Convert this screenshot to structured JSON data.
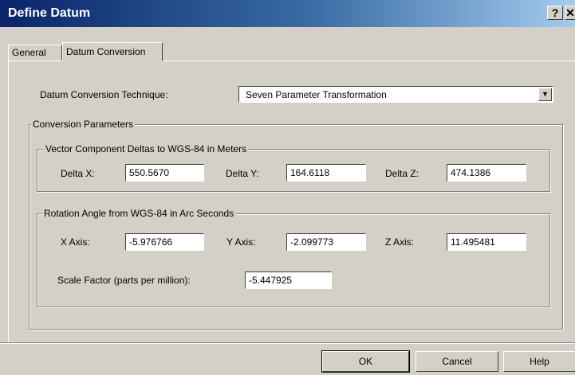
{
  "window": {
    "title": "Define Datum",
    "help_glyph": "?",
    "close_glyph": "✕"
  },
  "tabs": [
    {
      "label": "General",
      "active": false
    },
    {
      "label": "Datum Conversion",
      "active": true
    }
  ],
  "technique": {
    "label": "Datum Conversion Technique:",
    "value": "Seven Parameter Transformation"
  },
  "conversion_params": {
    "legend": "Conversion Parameters",
    "vector_group": {
      "legend": "Vector Component Deltas to WGS-84 in Meters",
      "delta_x_label": "Delta X:",
      "delta_x_value": "550.5670",
      "delta_y_label": "Delta Y:",
      "delta_y_value": "164.6118",
      "delta_z_label": "Delta Z:",
      "delta_z_value": "474.1386"
    },
    "rotation_group": {
      "legend": "Rotation Angle from WGS-84 in Arc Seconds",
      "x_label": "X Axis:",
      "x_value": "-5.976766",
      "y_label": "Y Axis:",
      "y_value": "-2.099773",
      "z_label": "Z Axis:",
      "z_value": "11.495481",
      "scale_label": "Scale Factor (parts per million):",
      "scale_value": "-5.447925"
    }
  },
  "buttons": {
    "ok": "OK",
    "cancel": "Cancel",
    "help": "Help"
  }
}
